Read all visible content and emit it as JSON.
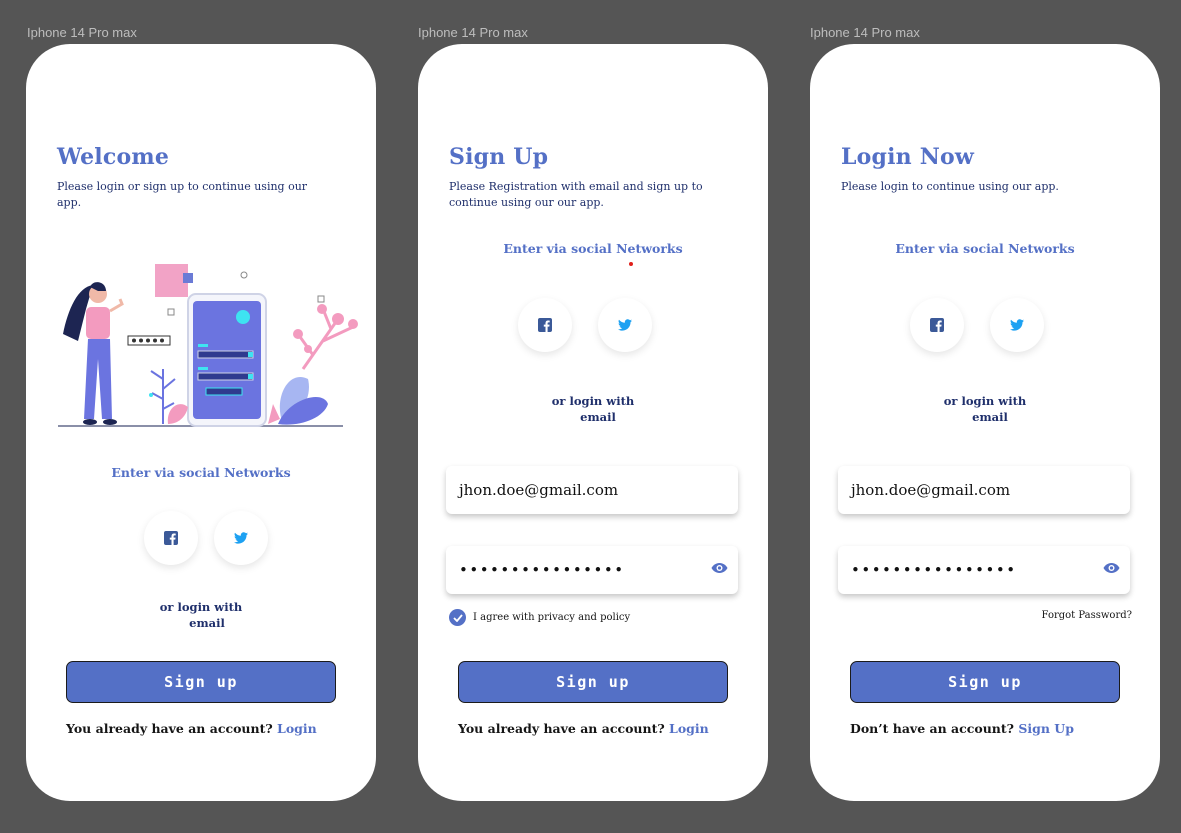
{
  "frames": [
    {
      "label": "Iphone 14 Pro max",
      "title": "Welcome",
      "subtitle": "Please login or sign up to continue using our app.",
      "social_heading": "Enter via social Networks",
      "alt_line1": "or login with",
      "alt_line2": "email",
      "button_label": "Sign up",
      "footer_text": "You already have an account?",
      "footer_link": "Login"
    },
    {
      "label": "Iphone 14 Pro max",
      "title": "Sign Up",
      "subtitle": "Please Registration with email and sign up to continue using our our app.",
      "social_heading": "Enter via social Networks",
      "alt_line1": "or login with",
      "alt_line2": "email",
      "email_value": "jhon.doe@gmail.com",
      "password_value": "••••••••••••••••",
      "checkbox_label": "I agree with privacy and policy",
      "button_label": "Sign up",
      "footer_text": "You already have an account?",
      "footer_link": "Login"
    },
    {
      "label": "Iphone 14 Pro max",
      "title": "Login Now",
      "subtitle": "Please login to continue using our app.",
      "social_heading": "Enter via social Networks",
      "alt_line1": "or login with",
      "alt_line2": "email",
      "email_value": "jhon.doe@gmail.com",
      "password_value": "••••••••••••••••",
      "forgot_label": "Forgot Password?",
      "button_label": "Sign up",
      "footer_text": "Don’t have an account?",
      "footer_link": "Sign Up"
    }
  ],
  "icons": {
    "facebook": "facebook-icon",
    "twitter": "twitter-icon",
    "eye": "eye-icon",
    "check": "check-icon"
  },
  "colors": {
    "background": "#555555",
    "primary": "#5470c6",
    "text_dark": "#1f2f6b",
    "facebook": "#3b5998",
    "twitter": "#1da1f2"
  }
}
